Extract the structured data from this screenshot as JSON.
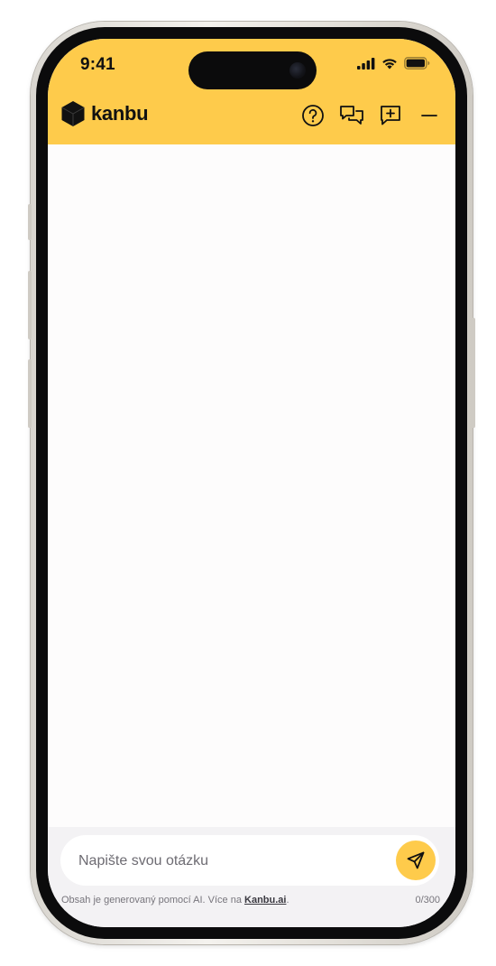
{
  "status_bar": {
    "time": "9:41"
  },
  "header": {
    "brand_name": "kanbu",
    "accent_color": "#fecb4b",
    "actions": [
      {
        "icon": "help-circle-icon",
        "label": "Help"
      },
      {
        "icon": "conversations-icon",
        "label": "Conversations"
      },
      {
        "icon": "new-chat-icon",
        "label": "New chat"
      },
      {
        "icon": "minimize-icon",
        "label": "Minimize"
      }
    ]
  },
  "composer": {
    "placeholder": "Napište svou otázku",
    "value": "",
    "send_icon": "send-icon",
    "char_counter": "0/300"
  },
  "disclaimer": {
    "text": "Obsah je generovaný pomocí AI. Více na",
    "link_text": "Kanbu.ai",
    "suffix": "."
  }
}
